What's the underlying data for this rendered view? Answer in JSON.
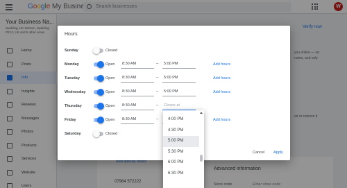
{
  "app": {
    "logo_google": [
      "G",
      "o",
      "o",
      "g",
      "l",
      "e"
    ],
    "logo_product": "My Business",
    "search_placeholder": "Search businesses",
    "avatar_initial": "W"
  },
  "sidebar": {
    "business_name": "Your Business Na...",
    "address": "Spalding, UK Weston, Spalding PE12, UK and 5 other areas",
    "items": [
      {
        "label": "Home",
        "active": false
      },
      {
        "label": "Posts",
        "active": false
      },
      {
        "label": "Info",
        "active": true
      },
      {
        "label": "Insights",
        "active": false
      },
      {
        "label": "Reviews",
        "active": false
      },
      {
        "label": "Messages",
        "active": false
      },
      {
        "label": "Photos",
        "active": false
      },
      {
        "label": "Products",
        "active": false
      },
      {
        "label": "Services",
        "active": false
      },
      {
        "label": "Website",
        "active": false
      },
      {
        "label": "Users",
        "active": false
      }
    ]
  },
  "background": {
    "verify_link": "Verify now",
    "snippet_1": "you online — on",
    "snippet_2": "nutes, and only",
    "snippet_3": "ed or remove it",
    "special_hours": "Add special hours",
    "phone": "07964 572222",
    "advanced_info": "Advanced information",
    "store_code_label": "Store code",
    "store_code_placeholder": "Enter store code"
  },
  "dialog": {
    "title": "Hours",
    "add_hours_label": "Add hours",
    "dash": "–",
    "closes_at_placeholder": "Closes at",
    "days": [
      {
        "day": "Sunday",
        "status": "Closed",
        "open": false
      },
      {
        "day": "Monday",
        "status": "Open",
        "open": true,
        "opens": "8:30 AM",
        "closes": "5:00 PM"
      },
      {
        "day": "Tuesday",
        "status": "Open",
        "open": true,
        "opens": "8:30 AM",
        "closes": "5:00 PM"
      },
      {
        "day": "Wednesday",
        "status": "Open",
        "open": true,
        "opens": "8:30 AM",
        "closes": "5:00 PM"
      },
      {
        "day": "Thursday",
        "status": "Open",
        "open": true,
        "opens": "8:30 AM",
        "closes": ""
      },
      {
        "day": "Friday",
        "status": "Open",
        "open": true,
        "opens": "8:30 AM",
        "closes": "5:00 PM"
      },
      {
        "day": "Saturday",
        "status": "Closed",
        "open": false
      }
    ],
    "cancel_label": "Cancel",
    "apply_label": "Apply"
  },
  "dropdown": {
    "options": [
      "4:00 PM",
      "4:30 PM",
      "5:00 PM",
      "5:30 PM",
      "6:00 PM",
      "6:30 PM"
    ],
    "selected": "5:00 PM"
  },
  "colors": {
    "accent": "#1a73e8",
    "active_nav_bg": "#e8f0fe",
    "scrim": "rgba(0,0,0,0.42)"
  }
}
